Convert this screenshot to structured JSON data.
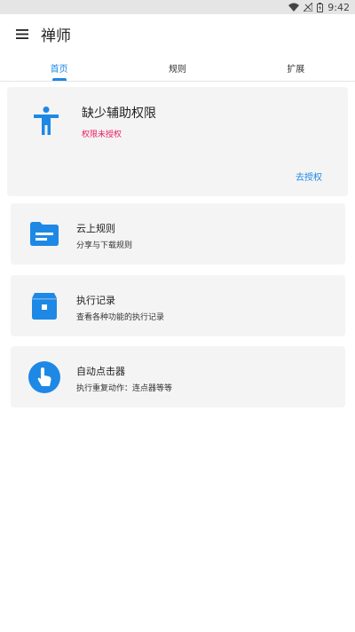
{
  "status_bar": {
    "time": "9:42"
  },
  "app_bar": {
    "title": "禅师"
  },
  "tabs": [
    {
      "label": "首页",
      "active": true
    },
    {
      "label": "规则",
      "active": false
    },
    {
      "label": "扩展",
      "active": false
    }
  ],
  "permission_card": {
    "title": "缺少辅助权限",
    "subtitle": "权限未授权",
    "action": "去授权"
  },
  "features": [
    {
      "title": "云上规则",
      "subtitle": "分享与下载规则",
      "icon": "folder-icon"
    },
    {
      "title": "执行记录",
      "subtitle": "查看各种功能的执行记录",
      "icon": "archive-icon"
    },
    {
      "title": "自动点击器",
      "subtitle": "执行重复动作：连点器等等",
      "icon": "touch-icon"
    }
  ],
  "colors": {
    "accent": "#1e88e5",
    "warning": "#e91e63",
    "card": "#f4f4f4"
  }
}
